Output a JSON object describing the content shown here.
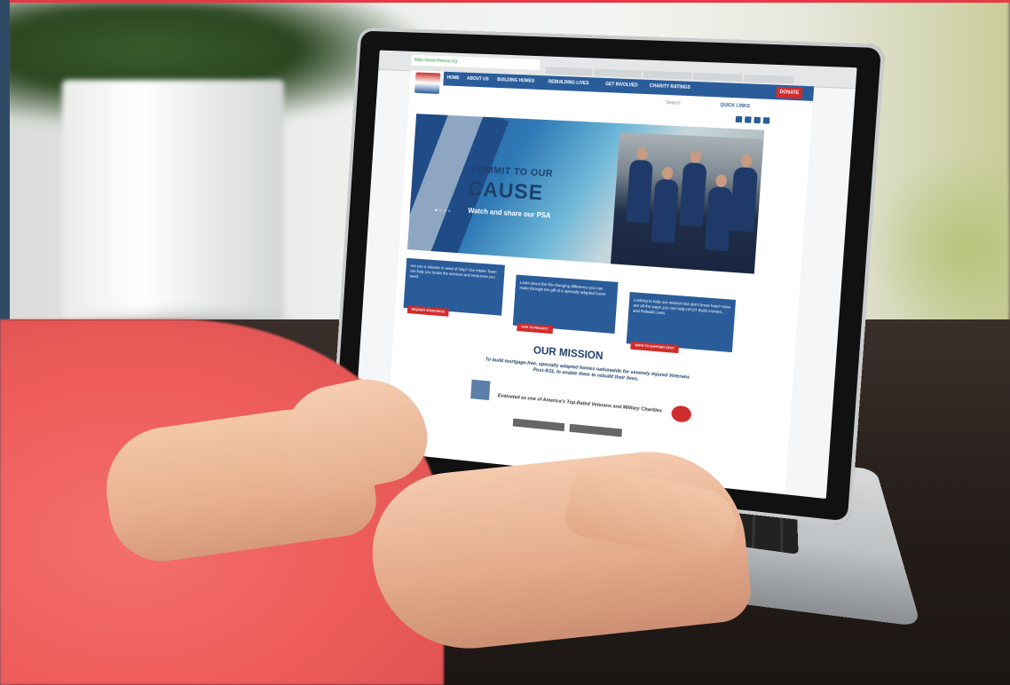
{
  "browser": {
    "url": "https://www.hfotusa.org"
  },
  "site": {
    "nav": [
      "HOME",
      "ABOUT US",
      "BUILDING HOMES",
      "REBUILDING LIVES",
      "GET INVOLVED",
      "CHARITY RATINGS"
    ],
    "donate_label": "DONATE",
    "search_placeholder": "Search",
    "quick_links": "QUICK LINKS",
    "hero": {
      "line1": "COMMIT TO OUR",
      "line2": "CAUSE",
      "subtitle": "Watch and share our PSA"
    },
    "boxes": [
      {
        "text": "Are you a Veteran in need of help? Our Intake Team can help you locate the services and resources you need.",
        "button": "REQUEST ASSISTANCE"
      },
      {
        "text": "Learn about the life-changing difference you can make through the gift of a specially adapted home.",
        "button": "GIVE TO PROJECT"
      },
      {
        "text": "Looking to help our mission but don't know how? Here are all the ways you can help HFOT Build Homes... and Rebuild Lives.",
        "button": "WAYS TO SUPPORT HFOT"
      }
    ],
    "mission": {
      "title": "OUR MISSION",
      "text": "To build mortgage-free, specially adapted homes nationwide for severely injured Veterans Post-9/11, to enable them to rebuild their lives.",
      "rated": "Evaluated as one of America's Top-Rated Veterans and Military Charities"
    }
  },
  "colors": {
    "brand_blue": "#2a5c9a",
    "brand_red": "#d12c2c",
    "sleeve": "#ee5d5c"
  }
}
